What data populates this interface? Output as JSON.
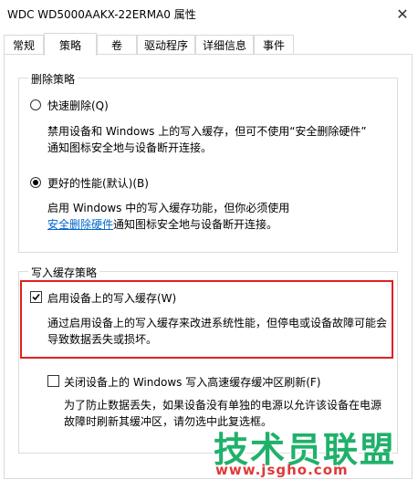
{
  "window": {
    "title": "WDC WD5000AAKX-22ERMA0 属性",
    "close_glyph": "✕"
  },
  "tabs": [
    {
      "label": "常规",
      "active": false
    },
    {
      "label": "策略",
      "active": true
    },
    {
      "label": "卷",
      "active": false
    },
    {
      "label": "驱动程序",
      "active": false
    },
    {
      "label": "详细信息",
      "active": false
    },
    {
      "label": "事件",
      "active": false
    }
  ],
  "removal_policy": {
    "title": "删除策略",
    "quick_removal": {
      "label": "快速删除(Q)",
      "checked": false,
      "desc_line1": "禁用设备和 Windows 上的写入缓存，但可不使用“安全删除硬件”",
      "desc_line2": "通知图标安全地与设备断开连接。"
    },
    "better_performance": {
      "label": "更好的性能(默认)(B)",
      "checked": true,
      "desc_line1": "启用 Windows 中的写入缓存功能，但你必须使用",
      "desc_link": "安全删除硬件",
      "desc_line2_rest": "通知图标安全地与设备断开连接。"
    }
  },
  "write_cache_policy": {
    "title": "写入缓存策略",
    "enable_cache": {
      "label": "启用设备上的写入缓存(W)",
      "checked": true,
      "desc_line1": "通过启用设备上的写入缓存来改进系统性能，但停电或设备故障可能会",
      "desc_line2": "导致数据丢失或损坏。"
    },
    "disable_flush": {
      "label": "关闭设备上的 Windows 写入高速缓存缓冲区刷新(F)",
      "checked": false,
      "desc_line1": "为了防止数据丢失，如果设备没有单独的电源以允许该设备在电源",
      "desc_line2": "故障时刷新其缓冲区，请勿选中此复选框。"
    }
  },
  "watermark": {
    "big": "技术员联盟",
    "small": "www.jsgho.com",
    "colors": {
      "big": "#1fb16a",
      "small": "#e03a3a"
    }
  },
  "highlight_color": "#e02020"
}
